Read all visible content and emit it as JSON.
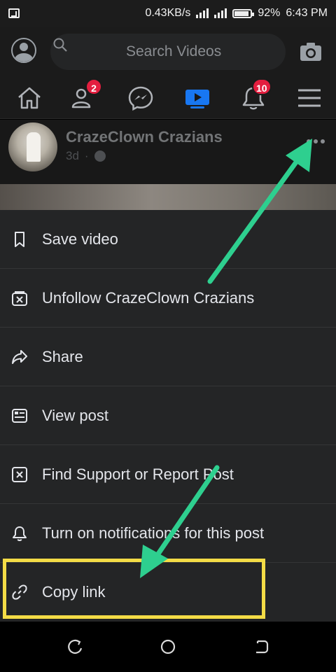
{
  "status_bar": {
    "network_speed": "0.43KB/s",
    "battery_percent": "92%",
    "time": "6:43 PM"
  },
  "search": {
    "placeholder": "Search Videos"
  },
  "nav": {
    "friends_badge": "2",
    "notifications_badge": "10"
  },
  "post": {
    "author": "CrazeClown Crazians",
    "age": "3d",
    "separator": "·"
  },
  "menu": {
    "items": [
      {
        "label": "Save video",
        "icon": "bookmark-icon"
      },
      {
        "label": "Unfollow CrazeClown Crazians",
        "icon": "unfollow-icon"
      },
      {
        "label": "Share",
        "icon": "share-icon"
      },
      {
        "label": "View post",
        "icon": "view-post-icon"
      },
      {
        "label": "Find Support or Report Post",
        "icon": "report-icon"
      },
      {
        "label": "Turn on notifications for this post",
        "icon": "bell-icon"
      },
      {
        "label": "Copy link",
        "icon": "link-icon"
      }
    ]
  },
  "colors": {
    "annotation_arrow": "#2ecf8f",
    "highlight_box": "#f4dc46",
    "badge": "#e41e3f",
    "watch_tab": "#1877f2"
  }
}
